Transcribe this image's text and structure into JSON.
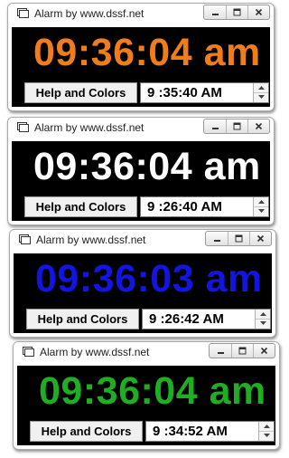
{
  "windows": [
    {
      "title": "Alarm by www.dssf.net",
      "clock_text": "09:36:04 am",
      "clock_color": "#f07c1a",
      "help_label": "Help and Colors",
      "alarm_time": "9 :35:40 AM"
    },
    {
      "title": "Alarm by www.dssf.net",
      "clock_text": "09:36:04 am",
      "clock_color": "#ffffff",
      "help_label": "Help and Colors",
      "alarm_time": "9 :26:40 AM"
    },
    {
      "title": "Alarm by www.dssf.net",
      "clock_text": "09:36:03 am",
      "clock_color": "#1414e0",
      "help_label": "Help and Colors",
      "alarm_time": "9 :26:42 AM"
    },
    {
      "title": "Alarm by www.dssf.net",
      "clock_text": "09:36:04 am",
      "clock_color": "#1fae22",
      "help_label": "Help and Colors",
      "alarm_time": "9 :34:52 AM"
    }
  ],
  "icons": {
    "app": "alarm-app-icon",
    "minimize": "minimize-icon",
    "maximize": "maximize-icon",
    "close": "close-icon",
    "spin_up": "chevron-up-icon",
    "spin_down": "chevron-down-icon"
  }
}
